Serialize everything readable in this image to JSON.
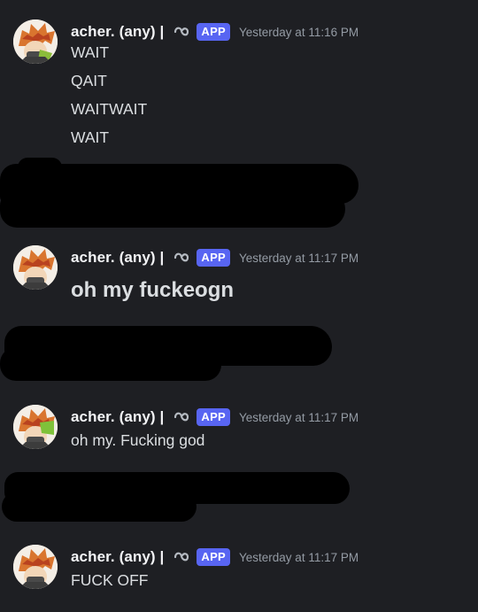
{
  "colors": {
    "background": "#1e1f23",
    "app_badge": "#5865f2",
    "username": "#f2f3f5",
    "timestamp": "#949ba4",
    "message_text": "#dbdee1",
    "redaction": "#000000"
  },
  "messages": [
    {
      "username": "acher. (any) |",
      "role_icon": "infinity-loop-icon",
      "badge": "APP",
      "timestamp": "Yesterday at 11:16 PM",
      "lines": [
        "WAIT",
        "QAIT",
        "WAITWAIT",
        "WAIT"
      ]
    },
    {
      "username": "acher. (any) |",
      "role_icon": "infinity-loop-icon",
      "badge": "APP",
      "timestamp": "Yesterday at 11:17 PM",
      "lines": [
        "oh my fuckeogn"
      ]
    },
    {
      "username": "acher. (any) |",
      "role_icon": "infinity-loop-icon",
      "badge": "APP",
      "timestamp": "Yesterday at 11:17 PM",
      "lines": [
        "oh my. Fucking god"
      ]
    },
    {
      "username": "acher. (any) |",
      "role_icon": "infinity-loop-icon",
      "badge": "APP",
      "timestamp": "Yesterday at 11:17 PM",
      "lines": [
        "FUCK OFF"
      ]
    }
  ]
}
